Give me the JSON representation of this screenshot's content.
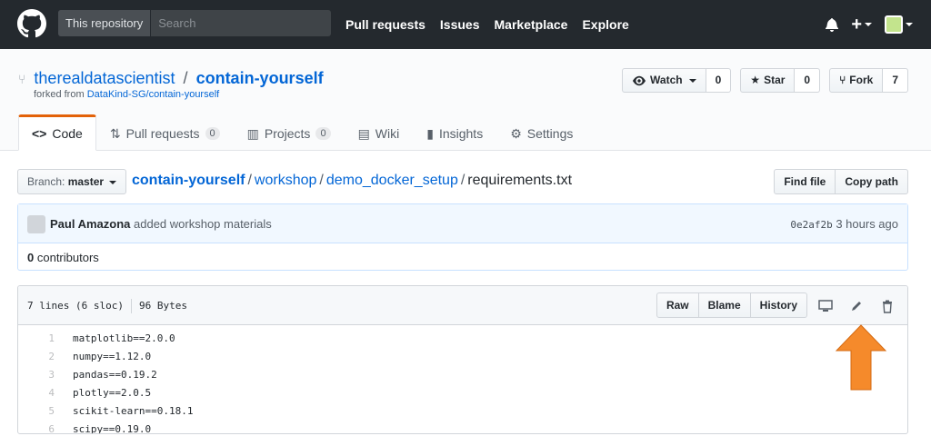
{
  "header": {
    "search_scope": "This repository",
    "search_placeholder": "Search",
    "nav": [
      "Pull requests",
      "Issues",
      "Marketplace",
      "Explore"
    ],
    "plus_label": "+"
  },
  "repo": {
    "owner": "therealdatascientist",
    "separator": "/",
    "name": "contain-yourself",
    "forked_prefix": "forked from",
    "forked_from": "DataKind-SG/contain-yourself",
    "watch_label": "Watch",
    "watch_count": "0",
    "star_label": "Star",
    "star_count": "0",
    "fork_label": "Fork",
    "fork_count": "7"
  },
  "tabs": [
    {
      "label": "Code",
      "icon": "code-icon",
      "count": null
    },
    {
      "label": "Pull requests",
      "icon": "pull-request-icon",
      "count": "0"
    },
    {
      "label": "Projects",
      "icon": "project-icon",
      "count": "0"
    },
    {
      "label": "Wiki",
      "icon": "book-icon",
      "count": null
    },
    {
      "label": "Insights",
      "icon": "graph-icon",
      "count": null
    },
    {
      "label": "Settings",
      "icon": "gear-icon",
      "count": null
    }
  ],
  "file_nav": {
    "branch_prefix": "Branch:",
    "branch": "master",
    "crumbs": [
      "contain-yourself",
      "workshop",
      "demo_docker_setup"
    ],
    "file": "requirements.txt",
    "find_file": "Find file",
    "copy_path": "Copy path"
  },
  "commit": {
    "author": "Paul Amazona",
    "message": "added workshop materials",
    "sha": "0e2af2b",
    "time": "3 hours ago",
    "contributors_count": "0",
    "contributors_label": "contributors"
  },
  "file": {
    "lines_info": "7 lines (6 sloc)",
    "size": "96 Bytes",
    "raw": "Raw",
    "blame": "Blame",
    "history": "History",
    "lines": [
      {
        "n": "1",
        "text": "matplotlib==2.0.0"
      },
      {
        "n": "2",
        "text": "numpy==1.12.0"
      },
      {
        "n": "3",
        "text": "pandas==0.19.2"
      },
      {
        "n": "4",
        "text": "plotly==2.0.5"
      },
      {
        "n": "5",
        "text": "scikit-learn==0.18.1"
      },
      {
        "n": "6",
        "text": "scipy==0.19.0"
      }
    ]
  },
  "colors": {
    "header_bg": "#24292e",
    "link": "#0366d6",
    "tab_accent": "#e36209",
    "arrow": "#f58a2b"
  }
}
